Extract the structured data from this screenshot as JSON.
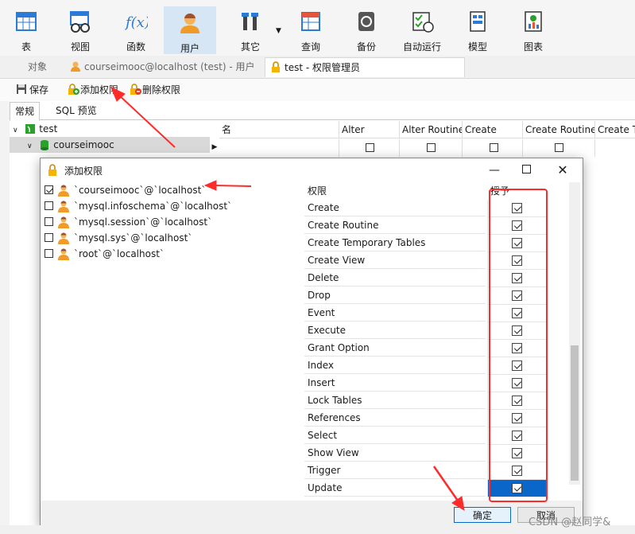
{
  "toolbar": {
    "items": [
      {
        "label": "表",
        "icon": "table-icon"
      },
      {
        "label": "视图",
        "icon": "view-icon"
      },
      {
        "label": "函数",
        "icon": "function-icon"
      },
      {
        "label": "用户",
        "icon": "user-icon"
      },
      {
        "label": "其它",
        "icon": "tools-icon"
      },
      {
        "label": "查询",
        "icon": "query-icon"
      },
      {
        "label": "备份",
        "icon": "backup-icon"
      },
      {
        "label": "自动运行",
        "icon": "schedule-icon"
      },
      {
        "label": "模型",
        "icon": "model-icon"
      },
      {
        "label": "图表",
        "icon": "chart-icon"
      }
    ],
    "active": "用户"
  },
  "tabs": [
    {
      "label": "对象"
    },
    {
      "label": "courseimooc@localhost (test) - 用户"
    },
    {
      "label": "test - 权限管理员"
    }
  ],
  "subbar": {
    "save": "保存",
    "add_priv": "添加权限",
    "del_priv": "删除权限"
  },
  "editor_tabs": [
    "常规",
    "SQL 预览"
  ],
  "bg_tree": {
    "root": "test",
    "child": "courseimooc"
  },
  "bg_grid_headers": [
    "名",
    "Alter",
    "Alter Routine",
    "Create",
    "Create Routine",
    "Create T"
  ],
  "dialog": {
    "title": "添加权限",
    "users": [
      {
        "name": "`courseimooc`@`localhost`",
        "checked": true
      },
      {
        "name": "`mysql.infoschema`@`localhost`",
        "checked": false
      },
      {
        "name": "`mysql.session`@`localhost`",
        "checked": false
      },
      {
        "name": "`mysql.sys`@`localhost`",
        "checked": false
      },
      {
        "name": "`root`@`localhost`",
        "checked": false
      }
    ],
    "col_priv": "权限",
    "col_grant": "授予",
    "privileges": [
      {
        "name": "Create",
        "granted": true
      },
      {
        "name": "Create Routine",
        "granted": true
      },
      {
        "name": "Create Temporary Tables",
        "granted": true
      },
      {
        "name": "Create View",
        "granted": true
      },
      {
        "name": "Delete",
        "granted": true
      },
      {
        "name": "Drop",
        "granted": true
      },
      {
        "name": "Event",
        "granted": true
      },
      {
        "name": "Execute",
        "granted": true
      },
      {
        "name": "Grant Option",
        "granted": true
      },
      {
        "name": "Index",
        "granted": true
      },
      {
        "name": "Insert",
        "granted": true
      },
      {
        "name": "Lock Tables",
        "granted": true
      },
      {
        "name": "References",
        "granted": true
      },
      {
        "name": "Select",
        "granted": true
      },
      {
        "name": "Show View",
        "granted": true
      },
      {
        "name": "Trigger",
        "granted": true
      },
      {
        "name": "Update",
        "granted": true
      }
    ],
    "selected_privilege": "Update",
    "ok": "确定",
    "cancel": "取消"
  },
  "watermark": "CSDN @赵同学&",
  "colors": {
    "accent": "#0b66c9",
    "annotation": "#ff2a2a",
    "toolbar_active": "#d6e6f5"
  }
}
